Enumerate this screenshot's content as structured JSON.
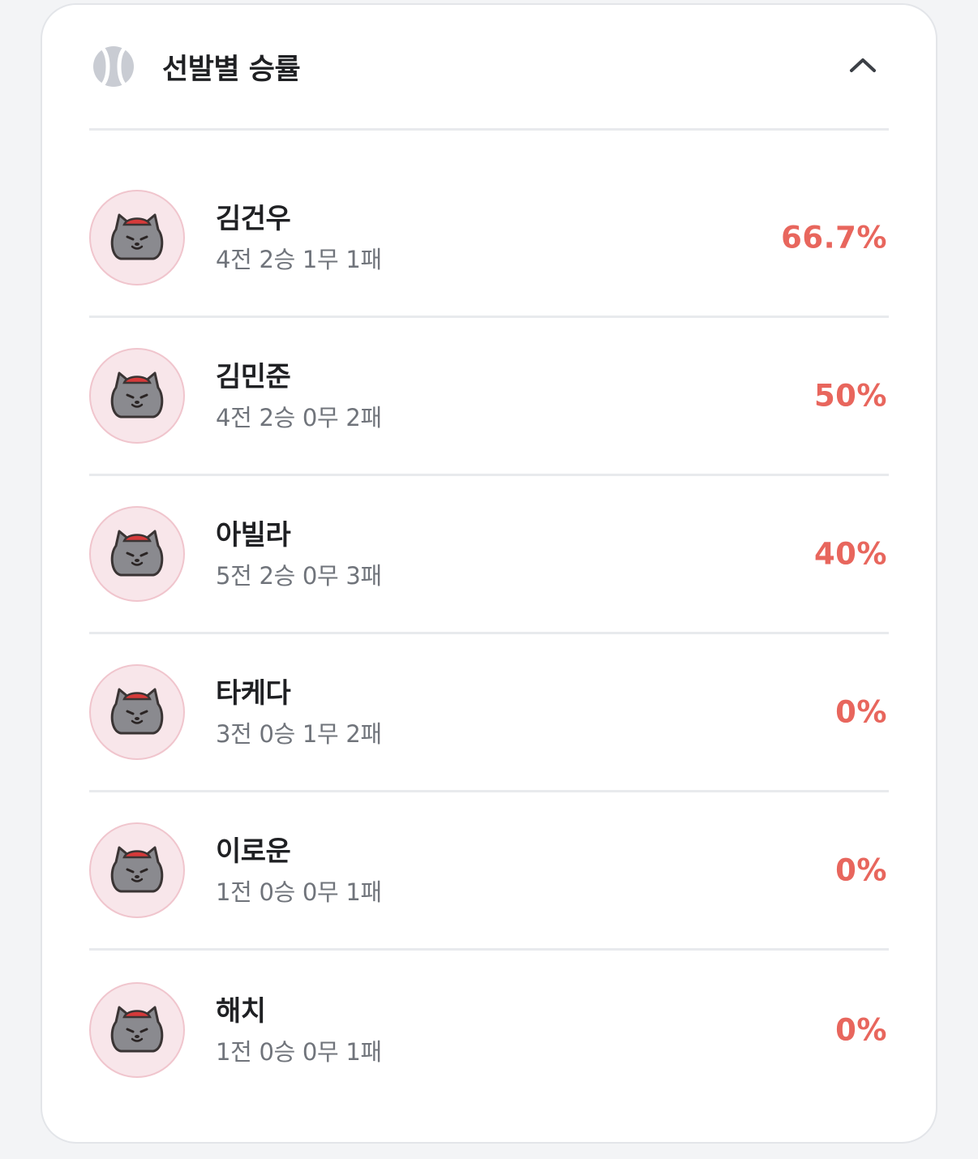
{
  "header": {
    "title": "선발별 승률",
    "icon": "baseball-icon",
    "toggle_icon": "chevron-up-icon"
  },
  "colors": {
    "accent": "#e8665d",
    "avatar_bg": "#f8e6ea",
    "text_primary": "#1f2023",
    "text_secondary": "#70747b"
  },
  "pitchers": [
    {
      "name": "김건우",
      "record": "4전 2승 1무 1패",
      "win_rate": "66.7%"
    },
    {
      "name": "김민준",
      "record": "4전 2승 0무 2패",
      "win_rate": "50%"
    },
    {
      "name": "아빌라",
      "record": "5전 2승 0무 3패",
      "win_rate": "40%"
    },
    {
      "name": "타케다",
      "record": "3전 0승 1무 2패",
      "win_rate": "0%"
    },
    {
      "name": "이로운",
      "record": "1전 0승 0무 1패",
      "win_rate": "0%"
    },
    {
      "name": "해치",
      "record": "1전 0승 0무 1패",
      "win_rate": "0%"
    }
  ]
}
